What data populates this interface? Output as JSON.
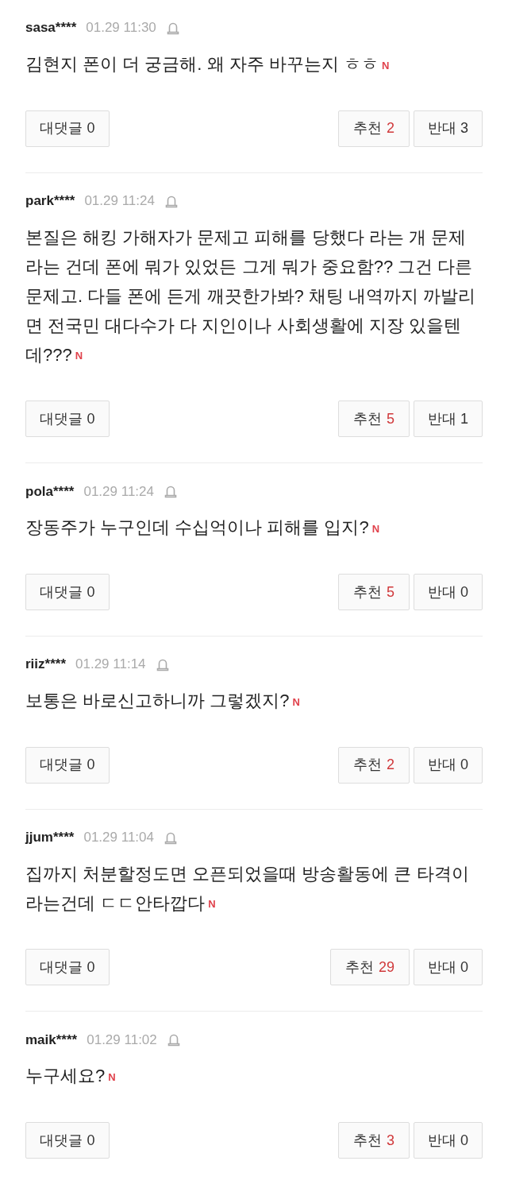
{
  "comments": [
    {
      "user": "sasa****",
      "time": "01.29 11:30",
      "text": "김현지 폰이 더 궁금해. 왜 자주 바꾸는지 ㅎㅎ",
      "new_mark": "N",
      "reply_label": "대댓글",
      "reply_count": "0",
      "like_label": "추천",
      "like_count": "2",
      "dislike_label": "반대",
      "dislike_count": "3"
    },
    {
      "user": "park****",
      "time": "01.29 11:24",
      "text": "본질은 해킹 가해자가 문제고 피해를 당했다 라는 개 문제라는 건데 폰에 뭐가 있었든 그게 뭐가 중요함?? 그건 다른 문제고. 다들 폰에 든게 깨끗한가봐? 채팅 내역까지 까발리면 전국민 대다수가 다 지인이나 사회생활에 지장 있을텐데???",
      "new_mark": "N",
      "reply_label": "대댓글",
      "reply_count": "0",
      "like_label": "추천",
      "like_count": "5",
      "dislike_label": "반대",
      "dislike_count": "1"
    },
    {
      "user": "pola****",
      "time": "01.29 11:24",
      "text": "장동주가 누구인데 수십억이나 피해를 입지?",
      "new_mark": "N",
      "reply_label": "대댓글",
      "reply_count": "0",
      "like_label": "추천",
      "like_count": "5",
      "dislike_label": "반대",
      "dislike_count": "0"
    },
    {
      "user": "riiz****",
      "time": "01.29 11:14",
      "text": "보통은 바로신고하니까 그렇겠지?",
      "new_mark": "N",
      "reply_label": "대댓글",
      "reply_count": "0",
      "like_label": "추천",
      "like_count": "2",
      "dislike_label": "반대",
      "dislike_count": "0"
    },
    {
      "user": "jjum****",
      "time": "01.29 11:04",
      "text": "집까지 처분할정도면 오픈되었을때 방송활동에 큰 타격이라는건데 ㄷㄷ안타깝다",
      "new_mark": "N",
      "reply_label": "대댓글",
      "reply_count": "0",
      "like_label": "추천",
      "like_count": "29",
      "dislike_label": "반대",
      "dislike_count": "0"
    },
    {
      "user": "maik****",
      "time": "01.29 11:02",
      "text": "누구세요?",
      "new_mark": "N",
      "reply_label": "대댓글",
      "reply_count": "0",
      "like_label": "추천",
      "like_count": "3",
      "dislike_label": "반대",
      "dislike_count": "0"
    }
  ]
}
